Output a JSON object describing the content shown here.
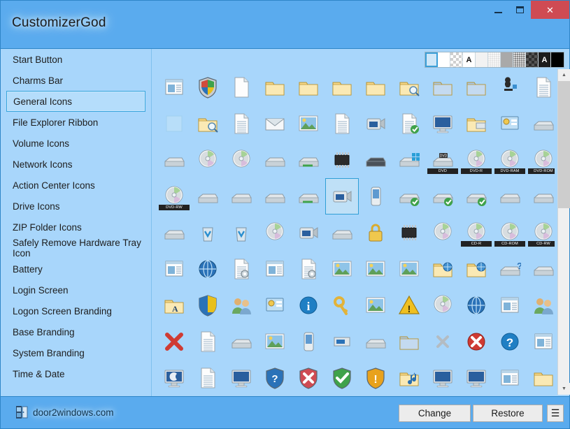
{
  "window": {
    "title": "CustomizerGod",
    "controls": [
      {
        "name": "minimize",
        "label": "–"
      },
      {
        "name": "maximize",
        "label": "❐"
      },
      {
        "name": "close",
        "label": "✕"
      }
    ]
  },
  "sidebar": {
    "items": [
      {
        "label": "Start Button",
        "selected": false
      },
      {
        "label": "Charms Bar",
        "selected": false
      },
      {
        "label": "General Icons",
        "selected": true
      },
      {
        "label": "File Explorer Ribbon",
        "selected": false
      },
      {
        "label": "Volume Icons",
        "selected": false
      },
      {
        "label": "Network Icons",
        "selected": false
      },
      {
        "label": "Action Center Icons",
        "selected": false
      },
      {
        "label": "Drive Icons",
        "selected": false
      },
      {
        "label": "ZIP Folder Icons",
        "selected": false
      },
      {
        "label": "Safely Remove Hardware Tray Icon",
        "selected": false
      },
      {
        "label": "Battery",
        "selected": false
      },
      {
        "label": "Login Screen",
        "selected": false
      },
      {
        "label": "Logon Screen Branding",
        "selected": false
      },
      {
        "label": "Base Branding",
        "selected": false
      },
      {
        "label": "System Branding",
        "selected": false
      },
      {
        "label": "Time & Date",
        "selected": false
      }
    ]
  },
  "swatchbar": {
    "swatches": [
      {
        "name": "swatch-blue-selected",
        "kind": "solid",
        "color": "#cfe7f8",
        "label": "",
        "selected": true
      },
      {
        "name": "swatch-white",
        "kind": "solid",
        "color": "#ffffff",
        "label": "",
        "selected": false
      },
      {
        "name": "swatch-checker-light",
        "kind": "checker",
        "color": "#ffffff",
        "label": "",
        "selected": false
      },
      {
        "name": "swatch-letter-a-light",
        "kind": "solid",
        "color": "#ffffff",
        "label": "A",
        "selected": false
      },
      {
        "name": "swatch-near-white",
        "kind": "solid",
        "color": "#f2f2f2",
        "label": "",
        "selected": false
      },
      {
        "name": "swatch-dots-light",
        "kind": "dots",
        "color": "#e4e4e4",
        "label": "",
        "selected": false
      },
      {
        "name": "swatch-gray",
        "kind": "solid",
        "color": "#a9a9a9",
        "label": "",
        "selected": false
      },
      {
        "name": "swatch-dots-dark",
        "kind": "dots",
        "color": "#8a8a8a",
        "label": "",
        "selected": false
      },
      {
        "name": "swatch-checker-dark",
        "kind": "checker",
        "color": "#2e2e2e",
        "label": "",
        "selected": false
      },
      {
        "name": "swatch-letter-a-dark",
        "kind": "solid",
        "color": "#1c1c1c",
        "label": "A",
        "selected": false
      },
      {
        "name": "swatch-black",
        "kind": "solid",
        "color": "#000000",
        "label": "",
        "selected": false
      }
    ]
  },
  "icon_grid": {
    "columns": 12,
    "selected_index": 41,
    "icons": [
      {
        "name": "windows-logo-classic",
        "label": ""
      },
      {
        "name": "shield-windows-security",
        "label": ""
      },
      {
        "name": "blank-document",
        "label": ""
      },
      {
        "name": "folder-closed",
        "label": ""
      },
      {
        "name": "folder-closed-2",
        "label": ""
      },
      {
        "name": "folder-open-back",
        "label": ""
      },
      {
        "name": "folder-tall",
        "label": ""
      },
      {
        "name": "folder-search",
        "label": ""
      },
      {
        "name": "folder-blue-document",
        "label": ""
      },
      {
        "name": "folder-blue-narrow",
        "label": ""
      },
      {
        "name": "games-chess-puzzle",
        "label": ""
      },
      {
        "name": "window-document-list",
        "label": ""
      },
      {
        "name": "empty-slot",
        "label": ""
      },
      {
        "name": "folder-search-magnifier",
        "label": ""
      },
      {
        "name": "text-document-lined",
        "label": ""
      },
      {
        "name": "email-envelope",
        "label": ""
      },
      {
        "name": "picture-window",
        "label": ""
      },
      {
        "name": "music-sheet-document",
        "label": ""
      },
      {
        "name": "film-strip-video",
        "label": ""
      },
      {
        "name": "document-checked",
        "label": ""
      },
      {
        "name": "network-globe-monitor",
        "label": ""
      },
      {
        "name": "folder-printer",
        "label": ""
      },
      {
        "name": "control-panel-settings",
        "label": ""
      },
      {
        "name": "floppy-drive-purple",
        "label": ""
      },
      {
        "name": "drive-removable",
        "label": ""
      },
      {
        "name": "drive-cd",
        "label": ""
      },
      {
        "name": "drive-disconnected",
        "label": ""
      },
      {
        "name": "drive-hard-disk",
        "label": ""
      },
      {
        "name": "drive-network-connected",
        "label": ""
      },
      {
        "name": "chip-memory",
        "label": ""
      },
      {
        "name": "drive-dark",
        "label": ""
      },
      {
        "name": "drive-windows",
        "label": ""
      },
      {
        "name": "drive-dvd",
        "label": "DVD"
      },
      {
        "name": "disc-dvd-r",
        "label": "DVD-R"
      },
      {
        "name": "disc-dvd-ram",
        "label": "DVD-RAM"
      },
      {
        "name": "disc-dvd-rom",
        "label": "DVD-ROM"
      },
      {
        "name": "disc-dvd-rw",
        "label": "DVD-RW"
      },
      {
        "name": "drive-blue-slim",
        "label": ""
      },
      {
        "name": "drive-tape",
        "label": ""
      },
      {
        "name": "drive-blue-disk",
        "label": ""
      },
      {
        "name": "printer-network",
        "label": ""
      },
      {
        "name": "camcorder-video-device",
        "label": ""
      },
      {
        "name": "mobile-phone",
        "label": ""
      },
      {
        "name": "printer-floppy-check",
        "label": ""
      },
      {
        "name": "printer-check",
        "label": ""
      },
      {
        "name": "printer-check-green",
        "label": ""
      },
      {
        "name": "printer-default",
        "label": ""
      },
      {
        "name": "printer-floppy",
        "label": ""
      },
      {
        "name": "printer-plain",
        "label": ""
      },
      {
        "name": "recycle-bin-empty",
        "label": ""
      },
      {
        "name": "recycle-bin-full",
        "label": ""
      },
      {
        "name": "disc-generic",
        "label": ""
      },
      {
        "name": "camera-digital",
        "label": ""
      },
      {
        "name": "scanner-flatbed",
        "label": ""
      },
      {
        "name": "padlock-security",
        "label": ""
      },
      {
        "name": "memory-card-sd",
        "label": ""
      },
      {
        "name": "disc-blank",
        "label": ""
      },
      {
        "name": "disc-cd-r",
        "label": "CD-R"
      },
      {
        "name": "disc-cd-rom",
        "label": "CD-ROM"
      },
      {
        "name": "disc-cd-rw",
        "label": "CD-RW"
      },
      {
        "name": "book-blue-ribbon",
        "label": ""
      },
      {
        "name": "device-phone-sync",
        "label": ""
      },
      {
        "name": "document-settings",
        "label": ""
      },
      {
        "name": "settings-gear-window",
        "label": ""
      },
      {
        "name": "document-gear",
        "label": ""
      },
      {
        "name": "paint-brush-picture",
        "label": ""
      },
      {
        "name": "picture-landscape-tree",
        "label": ""
      },
      {
        "name": "photo-lake",
        "label": ""
      },
      {
        "name": "folder-web-share",
        "label": ""
      },
      {
        "name": "folder-web-share-2",
        "label": ""
      },
      {
        "name": "drive-help-question",
        "label": ""
      },
      {
        "name": "fax-machine",
        "label": ""
      },
      {
        "name": "folder-fonts",
        "label": ""
      },
      {
        "name": "shield-blue-yellow",
        "label": ""
      },
      {
        "name": "users-group",
        "label": ""
      },
      {
        "name": "tasks-checklist",
        "label": ""
      },
      {
        "name": "info-circle",
        "label": ""
      },
      {
        "name": "key-security",
        "label": ""
      },
      {
        "name": "photo-flowers",
        "label": ""
      },
      {
        "name": "warning-triangle",
        "label": ""
      },
      {
        "name": "disc-audio-music",
        "label": ""
      },
      {
        "name": "sync-update-circle",
        "label": ""
      },
      {
        "name": "help-book",
        "label": ""
      },
      {
        "name": "users-contacts",
        "label": ""
      },
      {
        "name": "delete-red-x",
        "label": ""
      },
      {
        "name": "document-rich-text",
        "label": ""
      },
      {
        "name": "drive-scanner",
        "label": ""
      },
      {
        "name": "banner-image",
        "label": ""
      },
      {
        "name": "pda-handheld",
        "label": ""
      },
      {
        "name": "network-device-blue",
        "label": ""
      },
      {
        "name": "scanner-flat",
        "label": ""
      },
      {
        "name": "folder-blue-shadow",
        "label": ""
      },
      {
        "name": "close-gray-x",
        "label": ""
      },
      {
        "name": "error-red-circle",
        "label": ""
      },
      {
        "name": "help-blue-question",
        "label": ""
      },
      {
        "name": "window-stack",
        "label": ""
      },
      {
        "name": "monitor-screensaver-moon",
        "label": ""
      },
      {
        "name": "notepad-document",
        "label": ""
      },
      {
        "name": "presentation-screen",
        "label": ""
      },
      {
        "name": "shield-help-question",
        "label": ""
      },
      {
        "name": "shield-error-red",
        "label": ""
      },
      {
        "name": "shield-ok-green",
        "label": ""
      },
      {
        "name": "shield-warning-orange",
        "label": ""
      },
      {
        "name": "folder-music",
        "label": ""
      },
      {
        "name": "monitor-desktop-blue",
        "label": ""
      },
      {
        "name": "monitor-screen",
        "label": ""
      },
      {
        "name": "install-package",
        "label": ""
      },
      {
        "name": "folder-open-light",
        "label": ""
      }
    ]
  },
  "scrollbar": {
    "up_arrow": "▲",
    "down_arrow": "▼"
  },
  "footer": {
    "brand": "door2windows.com",
    "change_label": "Change",
    "restore_label": "Restore",
    "menu_label": "☰"
  }
}
